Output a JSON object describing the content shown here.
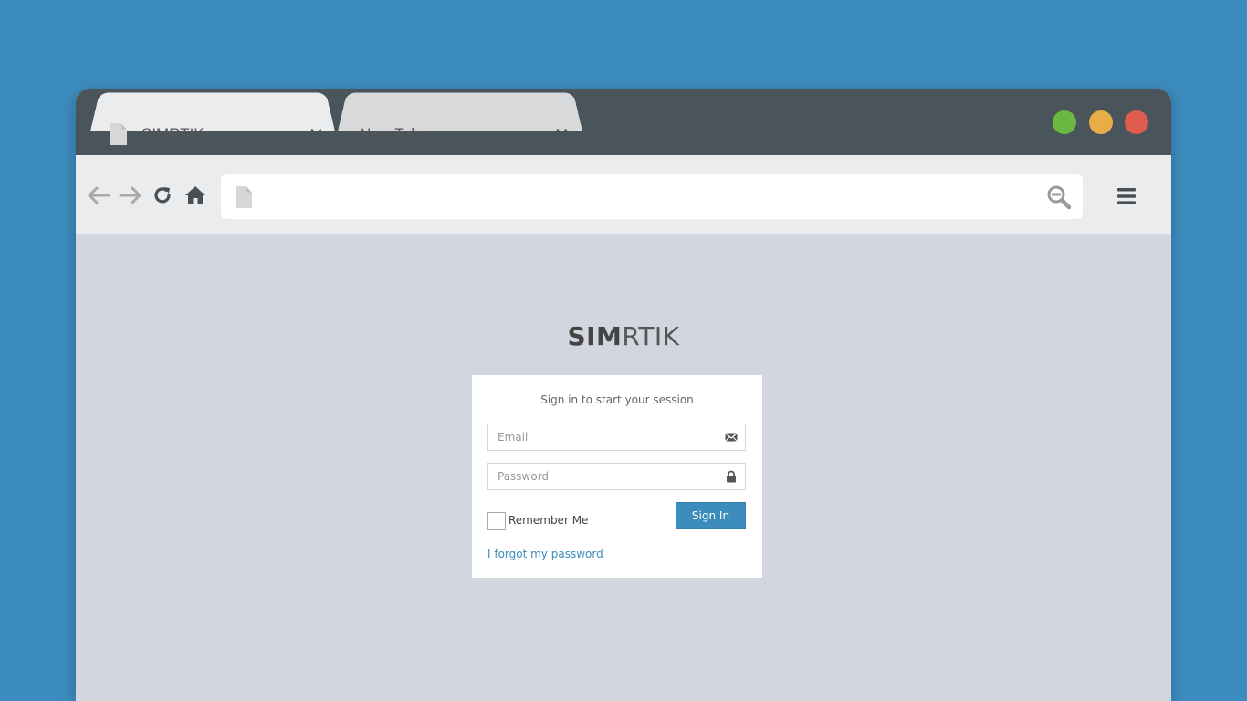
{
  "browser": {
    "tabs": [
      {
        "label": "SIMRTIK",
        "active": true
      },
      {
        "label": "New Tab",
        "active": false
      }
    ],
    "address": {
      "value": ""
    },
    "colors": {
      "titlebar": "#4a555b",
      "dot_green": "#6ab741",
      "dot_yellow": "#e7ad47",
      "dot_red": "#e05c4f",
      "background": "#3d8cbf"
    },
    "icons": [
      "back-arrow-icon",
      "forward-arrow-icon",
      "reload-icon",
      "home-icon",
      "search-icon",
      "hamburger-menu-icon"
    ]
  },
  "page": {
    "logo_bold": "SIM",
    "logo_light": "RTIK",
    "login_message": "Sign in to start your session",
    "email_placeholder": "Email",
    "password_placeholder": "Password",
    "remember_label": "Remember Me",
    "signin_label": "Sign In",
    "forgot_label": "I forgot my password",
    "accent": "#3c8dbc"
  }
}
